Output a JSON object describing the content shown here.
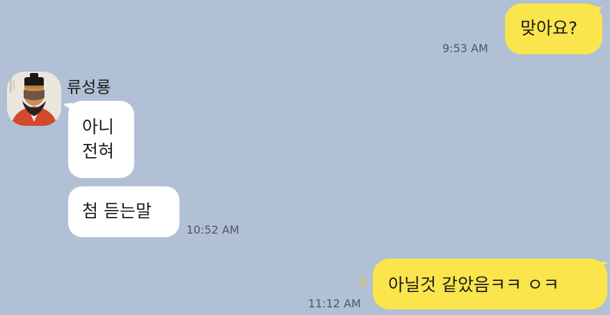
{
  "chat": {
    "sender": {
      "name": "류성룡",
      "avatar_icon": "portrait-avatar-icon"
    },
    "messages": [
      {
        "from": "me",
        "text": "맞아요?",
        "time": "9:53 AM"
      },
      {
        "from": "them",
        "lines": [
          "아니",
          "전혀"
        ]
      },
      {
        "from": "them",
        "text": "첨 듣는말",
        "time": "10:52 AM"
      },
      {
        "from": "me",
        "text": "아닐것 같았음ㅋㅋ ㅇㅋ",
        "time": "11:12 AM",
        "unread": "1"
      }
    ]
  },
  "colors": {
    "background": "#b1c0d4",
    "my_bubble": "#fae54d",
    "their_bubble": "#ffffff",
    "unread_count": "#e7c31d"
  }
}
